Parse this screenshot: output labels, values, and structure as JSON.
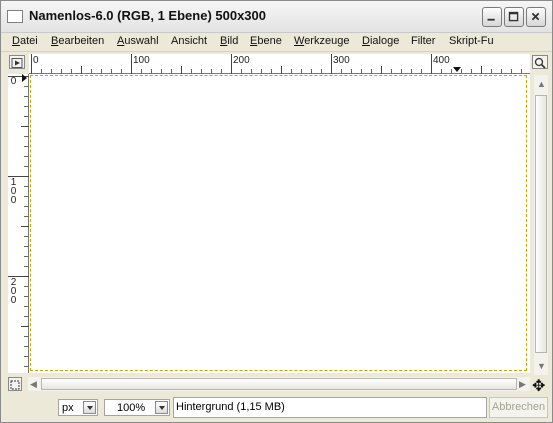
{
  "window": {
    "title": "Namenlos-6.0 (RGB, 1 Ebene) 500x300"
  },
  "menu": [
    "Datei",
    "Bearbeiten",
    "Auswahl",
    "Ansicht",
    "Bild",
    "Ebene",
    "Werkzeuge",
    "Dialoge",
    "Filter",
    "Skript-Fu"
  ],
  "ruler": {
    "horizontal_labels": [
      "0",
      "100",
      "200",
      "300",
      "400"
    ],
    "vertical_labels": [
      "0",
      "1\n0\n0",
      "2\n0\n0"
    ]
  },
  "statusbar": {
    "unit": "px",
    "zoom": "100%",
    "message": "Hintergrund (1,15 MB)",
    "cancel_label": "Abbrechen"
  },
  "icons": {
    "navigate": "navigate-icon",
    "zoom_fit": "zoom-fit-icon",
    "quick_mask": "quick-mask-icon",
    "pan": "move-icon"
  },
  "colors": {
    "canvas_border": "#c8a600",
    "window_bg": "#ece9d8"
  }
}
